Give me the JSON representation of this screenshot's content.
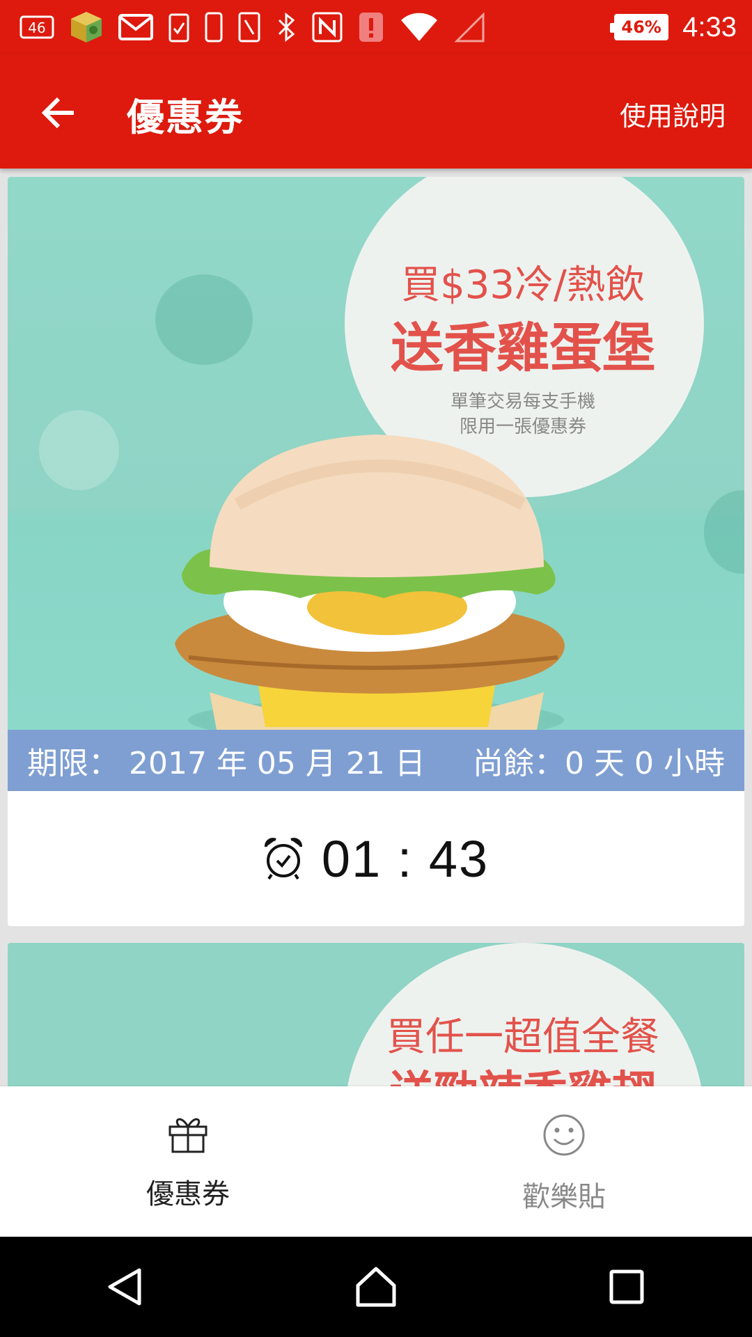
{
  "status_bar": {
    "signal_badge": "46",
    "battery_percent": "46%",
    "time": "4:33",
    "icons": [
      "sim-badge-icon",
      "app-cube-icon",
      "gmail-icon",
      "task-icon",
      "phone-icon",
      "tablet-icon",
      "bluetooth-icon",
      "nfc-icon",
      "alert-icon",
      "wifi-icon",
      "cell-signal-icon",
      "battery-icon"
    ]
  },
  "app_bar": {
    "title": "優惠券",
    "help_label": "使用說明",
    "background_color": "#dd1a0d"
  },
  "coupons": [
    {
      "promo_line1": "買$33冷/熱飲",
      "promo_line2": "送香雞蛋堡",
      "promo_note_line1": "單筆交易每支手機",
      "promo_note_line2": "限用一張優惠券",
      "expiry_label": "期限： 2017 年 05 月 21 日",
      "remaining_label": "尚餘：0 天 0 小時",
      "countdown": "01 : 43"
    },
    {
      "promo_line1": "買任一超值全餐",
      "promo_line2": "送勁辣香雞翅"
    }
  ],
  "tabs": [
    {
      "label": "優惠券",
      "icon": "gift-icon",
      "active": true
    },
    {
      "label": "歡樂貼",
      "icon": "smiley-icon",
      "active": false
    }
  ],
  "nav_bar": {
    "icons": [
      "back-triangle-icon",
      "home-icon",
      "recents-square-icon"
    ]
  }
}
